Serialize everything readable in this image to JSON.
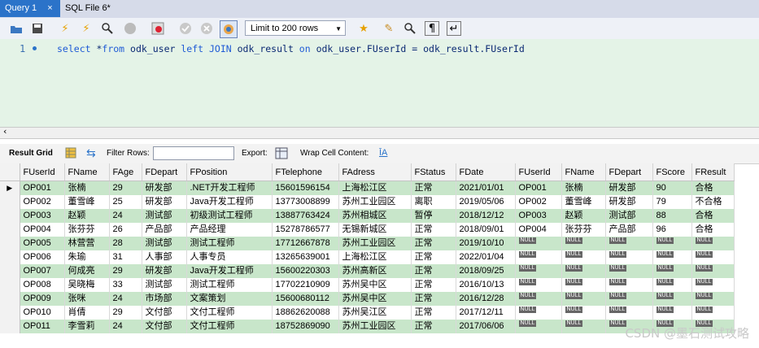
{
  "tabs": [
    {
      "label": "Query 1",
      "close": "×"
    },
    {
      "label": "SQL File 6*"
    }
  ],
  "toolbar": {
    "limit_label": "Limit to 200 rows"
  },
  "editor": {
    "line_number": "1",
    "tokens": [
      "select",
      " *",
      "from",
      " odk_user ",
      "left",
      " ",
      "JOIN",
      " odk_result ",
      "on",
      " odk_user.FUserId = odk_result.FUserId"
    ]
  },
  "result_bar": {
    "result_grid": "Result Grid",
    "filter_rows": "Filter Rows:",
    "export": "Export:",
    "wrap": "Wrap Cell Content:"
  },
  "grid": {
    "columns": [
      "FUserId",
      "FName",
      "FAge",
      "FDepart",
      "FPosition",
      "FTelephone",
      "FAdress",
      "FStatus",
      "FDate",
      "FUserId",
      "FName",
      "FDepart",
      "FScore",
      "FResult"
    ],
    "rows": [
      [
        "OP001",
        "张楠",
        "29",
        "研发部",
        ".NET开发工程师",
        "15601596154",
        "上海松江区",
        "正常",
        "2021/01/01",
        "OP001",
        "张楠",
        "研发部",
        "90",
        "合格"
      ],
      [
        "OP002",
        "董雪峰",
        "25",
        "研发部",
        "Java开发工程师",
        "13773008899",
        "苏州工业园区",
        "离职",
        "2019/05/06",
        "OP002",
        "董雪峰",
        "研发部",
        "79",
        "不合格"
      ],
      [
        "OP003",
        "赵颖",
        "24",
        "测试部",
        "初级测试工程师",
        "13887763424",
        "苏州相城区",
        "暂停",
        "2018/12/12",
        "OP003",
        "赵颖",
        "测试部",
        "88",
        "合格"
      ],
      [
        "OP004",
        "张芬芬",
        "26",
        "产品部",
        "产品经理",
        "15278786577",
        "无锡新城区",
        "正常",
        "2018/09/01",
        "OP004",
        "张芬芬",
        "产品部",
        "96",
        "合格"
      ],
      [
        "OP005",
        "林营营",
        "28",
        "测试部",
        "测试工程师",
        "17712667878",
        "苏州工业园区",
        "正常",
        "2019/10/10",
        "NULL",
        "NULL",
        "NULL",
        "NULL",
        "NULL"
      ],
      [
        "OP006",
        "朱瑜",
        "31",
        "人事部",
        "人事专员",
        "13265639001",
        "上海松江区",
        "正常",
        "2022/01/04",
        "NULL",
        "NULL",
        "NULL",
        "NULL",
        "NULL"
      ],
      [
        "OP007",
        "何成亮",
        "29",
        "研发部",
        "Java开发工程师",
        "15600220303",
        "苏州高新区",
        "正常",
        "2018/09/25",
        "NULL",
        "NULL",
        "NULL",
        "NULL",
        "NULL"
      ],
      [
        "OP008",
        "吴晓梅",
        "33",
        "测试部",
        "测试工程师",
        "17702210909",
        "苏州吴中区",
        "正常",
        "2016/10/13",
        "NULL",
        "NULL",
        "NULL",
        "NULL",
        "NULL"
      ],
      [
        "OP009",
        "张咪",
        "24",
        "市场部",
        "文案策划",
        "15600680112",
        "苏州吴中区",
        "正常",
        "2016/12/28",
        "NULL",
        "NULL",
        "NULL",
        "NULL",
        "NULL"
      ],
      [
        "OP010",
        "肖倩",
        "29",
        "文付部",
        "文付工程师",
        "18862620088",
        "苏州吴江区",
        "正常",
        "2017/12/11",
        "NULL",
        "NULL",
        "NULL",
        "NULL",
        "NULL"
      ],
      [
        "OP011",
        "李雪莉",
        "24",
        "文付部",
        "文付工程师",
        "18752869090",
        "苏州工业园区",
        "正常",
        "2017/06/06",
        "NULL",
        "NULL",
        "NULL",
        "NULL",
        "NULL"
      ]
    ]
  },
  "watermark": "CSDN @墨石测试攻略"
}
